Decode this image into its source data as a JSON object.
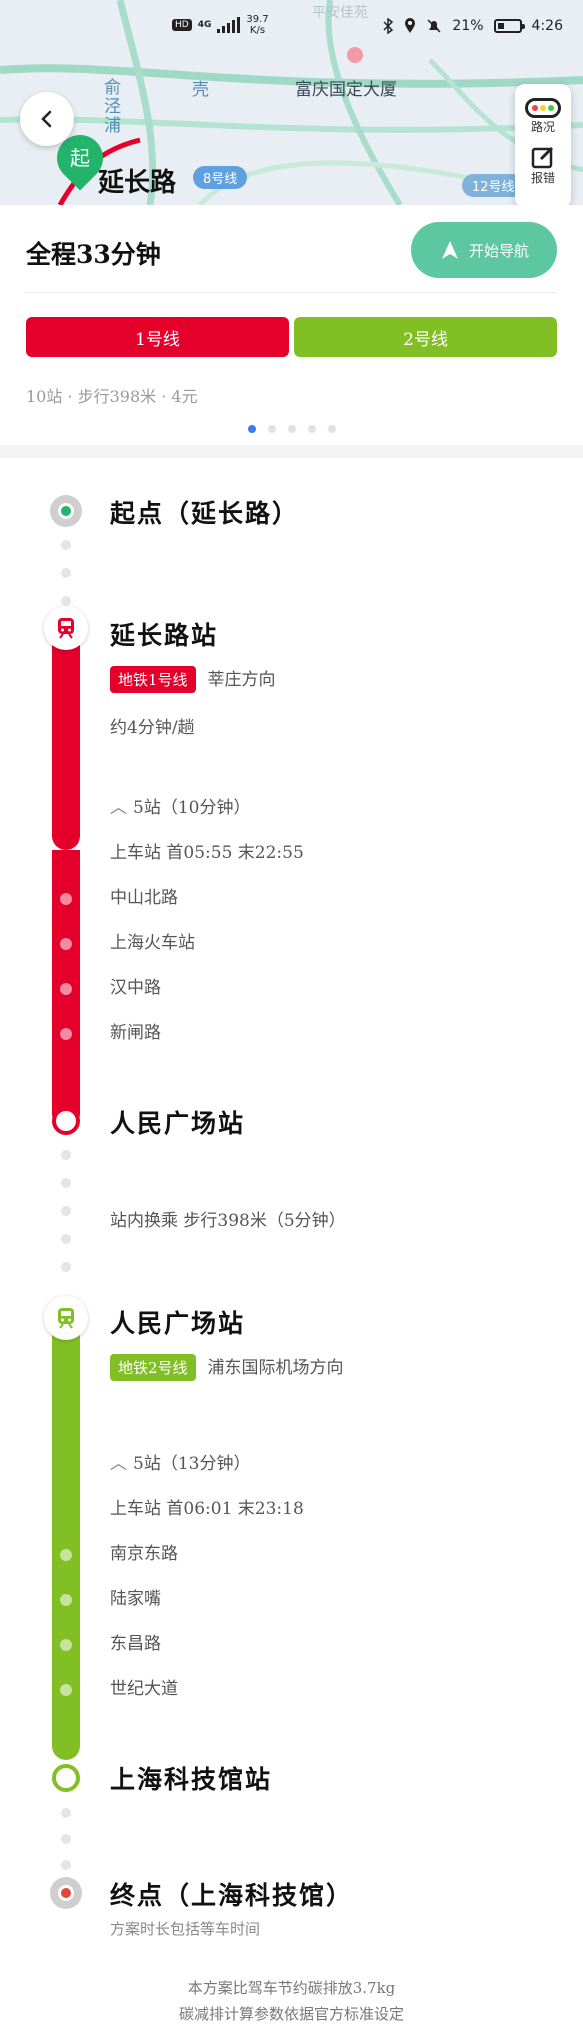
{
  "status_bar": {
    "hd": "HD",
    "network": "4G",
    "speed_value": "39.7",
    "speed_unit": "K/s",
    "battery": "21%",
    "time": "4:26"
  },
  "map": {
    "label_top": "平安佳苑",
    "label_building": "富庆国定大厦",
    "label_river": "俞泾浦",
    "label_station": "延长路",
    "label_line8": "8号线",
    "label_line12": "12号线",
    "label_partial": "壳",
    "start_pin": "起",
    "tool_traffic": "路况",
    "tool_report": "报错"
  },
  "summary": {
    "total_time": "全程33分钟",
    "navigate_label": "开始导航",
    "lines": [
      {
        "label": "1号线",
        "color": "#e4002b"
      },
      {
        "label": "2号线",
        "color": "#82bf25"
      }
    ],
    "meta": "10站 · 步行398米 · 4元",
    "page_count": 5,
    "page_active": 1
  },
  "route": {
    "origin": "起点（延长路）",
    "leg1": {
      "station": "延长路站",
      "line_badge": "地铁1号线",
      "direction": "莘庄方向",
      "frequency": "约4分钟/趟",
      "stops_summary": "5站（10分钟）",
      "schedule": "上车站  首05:55  末22:55",
      "stops": [
        "中山北路",
        "上海火车站",
        "汉中路",
        "新闸路"
      ],
      "alight": "人民广场站",
      "color": "#e4002b"
    },
    "transfer": "站内换乘  步行398米（5分钟）",
    "leg2": {
      "station": "人民广场站",
      "line_badge": "地铁2号线",
      "direction": "浦东国际机场方向",
      "stops_summary": "5站（13分钟）",
      "schedule": "上车站  首06:01  末23:18",
      "stops": [
        "南京东路",
        "陆家嘴",
        "东昌路",
        "世纪大道"
      ],
      "alight": "上海科技馆站",
      "color": "#82bf25"
    },
    "destination": "终点（上海科技馆）",
    "destination_note": "方案时长包括等车时间"
  },
  "footer": {
    "line1": "本方案比驾车节约碳排放3.7kg",
    "line2": "碳减排计算参数依据官方标准设定"
  }
}
